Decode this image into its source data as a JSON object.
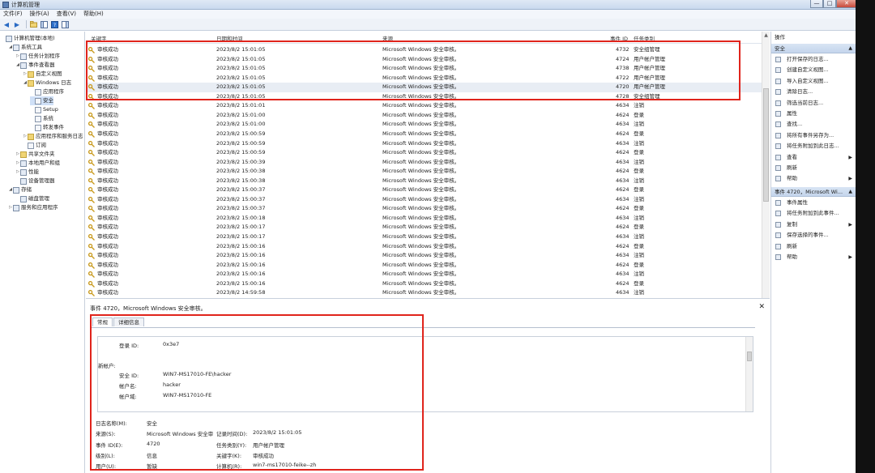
{
  "window": {
    "title": "计算机管理",
    "min": "—",
    "max": "□",
    "close": "✕"
  },
  "menu": [
    "文件(F)",
    "操作(A)",
    "查看(V)",
    "帮助(H)"
  ],
  "tree": [
    {
      "label": "计算机管理(本地)",
      "indent": 0,
      "tw": "",
      "icon": "computer-icon"
    },
    {
      "label": "系统工具",
      "indent": 1,
      "tw": "◢",
      "icon": "tools-icon"
    },
    {
      "label": "任务计划程序",
      "indent": 2,
      "tw": "▷",
      "icon": "clock-icon"
    },
    {
      "label": "事件查看器",
      "indent": 2,
      "tw": "◢",
      "icon": "event-viewer-icon"
    },
    {
      "label": "自定义视图",
      "indent": 3,
      "tw": "▷",
      "icon": "folder-icon"
    },
    {
      "label": "Windows 日志",
      "indent": 3,
      "tw": "◢",
      "icon": "folder-icon"
    },
    {
      "label": "应用程序",
      "indent": 4,
      "tw": "",
      "icon": "log-icon"
    },
    {
      "label": "安全",
      "indent": 4,
      "tw": "",
      "icon": "log-icon",
      "selected": true
    },
    {
      "label": "Setup",
      "indent": 4,
      "tw": "",
      "icon": "log-icon"
    },
    {
      "label": "系统",
      "indent": 4,
      "tw": "",
      "icon": "log-icon"
    },
    {
      "label": "转发事件",
      "indent": 4,
      "tw": "",
      "icon": "log-icon"
    },
    {
      "label": "应用程序和服务日志",
      "indent": 3,
      "tw": "▷",
      "icon": "folder-icon"
    },
    {
      "label": "订阅",
      "indent": 3,
      "tw": "",
      "icon": "log-icon"
    },
    {
      "label": "共享文件夹",
      "indent": 2,
      "tw": "▷",
      "icon": "shared-folder-icon"
    },
    {
      "label": "本地用户和组",
      "indent": 2,
      "tw": "▷",
      "icon": "users-icon"
    },
    {
      "label": "性能",
      "indent": 2,
      "tw": "▷",
      "icon": "performance-icon"
    },
    {
      "label": "设备管理器",
      "indent": 2,
      "tw": "",
      "icon": "device-icon"
    },
    {
      "label": "存储",
      "indent": 1,
      "tw": "◢",
      "icon": "storage-icon"
    },
    {
      "label": "磁盘管理",
      "indent": 2,
      "tw": "",
      "icon": "disk-icon"
    },
    {
      "label": "服务和应用程序",
      "indent": 1,
      "tw": "▷",
      "icon": "services-icon"
    }
  ],
  "columns": {
    "keyword": "关键字",
    "datetime": "日期和时间",
    "source": "来源",
    "event_id": "事件 ID",
    "category": "任务类别"
  },
  "events": [
    {
      "kw": "审核成功",
      "dt": "2023/8/2 15:01:05",
      "src": "Microsoft Windows 安全审核。",
      "id": "4732",
      "cat": "安全组管理"
    },
    {
      "kw": "审核成功",
      "dt": "2023/8/2 15:01:05",
      "src": "Microsoft Windows 安全审核。",
      "id": "4724",
      "cat": "用户帐户管理"
    },
    {
      "kw": "审核成功",
      "dt": "2023/8/2 15:01:05",
      "src": "Microsoft Windows 安全审核。",
      "id": "4738",
      "cat": "用户帐户管理"
    },
    {
      "kw": "审核成功",
      "dt": "2023/8/2 15:01:05",
      "src": "Microsoft Windows 安全审核。",
      "id": "4722",
      "cat": "用户帐户管理"
    },
    {
      "kw": "审核成功",
      "dt": "2023/8/2 15:01:05",
      "src": "Microsoft Windows 安全审核。",
      "id": "4720",
      "cat": "用户帐户管理",
      "selected": true
    },
    {
      "kw": "审核成功",
      "dt": "2023/8/2 15:01:05",
      "src": "Microsoft Windows 安全审核。",
      "id": "4728",
      "cat": "安全组管理"
    },
    {
      "kw": "审核成功",
      "dt": "2023/8/2 15:01:01",
      "src": "Microsoft Windows 安全审核。",
      "id": "4634",
      "cat": "注销"
    },
    {
      "kw": "审核成功",
      "dt": "2023/8/2 15:01:00",
      "src": "Microsoft Windows 安全审核。",
      "id": "4624",
      "cat": "登录"
    },
    {
      "kw": "审核成功",
      "dt": "2023/8/2 15:01:00",
      "src": "Microsoft Windows 安全审核。",
      "id": "4634",
      "cat": "注销"
    },
    {
      "kw": "审核成功",
      "dt": "2023/8/2 15:00:59",
      "src": "Microsoft Windows 安全审核。",
      "id": "4624",
      "cat": "登录"
    },
    {
      "kw": "审核成功",
      "dt": "2023/8/2 15:00:59",
      "src": "Microsoft Windows 安全审核。",
      "id": "4634",
      "cat": "注销"
    },
    {
      "kw": "审核成功",
      "dt": "2023/8/2 15:00:59",
      "src": "Microsoft Windows 安全审核。",
      "id": "4624",
      "cat": "登录"
    },
    {
      "kw": "审核成功",
      "dt": "2023/8/2 15:00:39",
      "src": "Microsoft Windows 安全审核。",
      "id": "4634",
      "cat": "注销"
    },
    {
      "kw": "审核成功",
      "dt": "2023/8/2 15:00:38",
      "src": "Microsoft Windows 安全审核。",
      "id": "4624",
      "cat": "登录"
    },
    {
      "kw": "审核成功",
      "dt": "2023/8/2 15:00:38",
      "src": "Microsoft Windows 安全审核。",
      "id": "4634",
      "cat": "注销"
    },
    {
      "kw": "审核成功",
      "dt": "2023/8/2 15:00:37",
      "src": "Microsoft Windows 安全审核。",
      "id": "4624",
      "cat": "登录"
    },
    {
      "kw": "审核成功",
      "dt": "2023/8/2 15:00:37",
      "src": "Microsoft Windows 安全审核。",
      "id": "4634",
      "cat": "注销"
    },
    {
      "kw": "审核成功",
      "dt": "2023/8/2 15:00:37",
      "src": "Microsoft Windows 安全审核。",
      "id": "4624",
      "cat": "登录"
    },
    {
      "kw": "审核成功",
      "dt": "2023/8/2 15:00:18",
      "src": "Microsoft Windows 安全审核。",
      "id": "4634",
      "cat": "注销"
    },
    {
      "kw": "审核成功",
      "dt": "2023/8/2 15:00:17",
      "src": "Microsoft Windows 安全审核。",
      "id": "4624",
      "cat": "登录"
    },
    {
      "kw": "审核成功",
      "dt": "2023/8/2 15:00:17",
      "src": "Microsoft Windows 安全审核。",
      "id": "4634",
      "cat": "注销"
    },
    {
      "kw": "审核成功",
      "dt": "2023/8/2 15:00:16",
      "src": "Microsoft Windows 安全审核。",
      "id": "4624",
      "cat": "登录"
    },
    {
      "kw": "审核成功",
      "dt": "2023/8/2 15:00:16",
      "src": "Microsoft Windows 安全审核。",
      "id": "4634",
      "cat": "注销"
    },
    {
      "kw": "审核成功",
      "dt": "2023/8/2 15:00:16",
      "src": "Microsoft Windows 安全审核。",
      "id": "4624",
      "cat": "登录"
    },
    {
      "kw": "审核成功",
      "dt": "2023/8/2 15:00:16",
      "src": "Microsoft Windows 安全审核。",
      "id": "4634",
      "cat": "注销"
    },
    {
      "kw": "审核成功",
      "dt": "2023/8/2 15:00:16",
      "src": "Microsoft Windows 安全审核。",
      "id": "4624",
      "cat": "登录"
    },
    {
      "kw": "审核成功",
      "dt": "2023/8/2 14:59:58",
      "src": "Microsoft Windows 安全审核。",
      "id": "4634",
      "cat": "注销"
    }
  ],
  "detail": {
    "title": "事件 4720，Microsoft Windows 安全审核。",
    "close": "✕",
    "tabs": [
      "常规",
      "详细信息"
    ],
    "desc_lines": [
      {
        "k": "登录 ID:",
        "v": "0x3e7",
        "indent": 1
      },
      {
        "k": "新帐户:",
        "v": "",
        "indent": 0
      },
      {
        "k": "安全 ID:",
        "v": "WIN7-MS17010-FE\\hacker",
        "indent": 1
      },
      {
        "k": "帐户名:",
        "v": "hacker",
        "indent": 1
      },
      {
        "k": "帐户域:",
        "v": "WIN7-MS17010-FE",
        "indent": 1
      }
    ],
    "props": [
      {
        "k": "日志名称(M):",
        "v": "安全",
        "k2": "",
        "v2": ""
      },
      {
        "k": "来源(S):",
        "v": "Microsoft Windows 安全审",
        "k2": "记录时间(D):",
        "v2": "2023/8/2 15:01:05"
      },
      {
        "k": "事件 ID(E):",
        "v": "4720",
        "k2": "任务类别(Y):",
        "v2": "用户帐户管理"
      },
      {
        "k": "级别(L):",
        "v": "信息",
        "k2": "关键字(K):",
        "v2": "审核成功"
      },
      {
        "k": "用户(U):",
        "v": "暂缺",
        "k2": "计算机(R):",
        "v2": "win7-ms17010-feike--zh"
      }
    ]
  },
  "actions": {
    "header": "操作",
    "section1": "安全",
    "items1": [
      {
        "label": "打开保存的日志...",
        "icon": "open-log-icon"
      },
      {
        "label": "创建自定义视图...",
        "icon": "filter-icon"
      },
      {
        "label": "导入自定义视图...",
        "icon": "import-icon"
      },
      {
        "label": "清除日志...",
        "icon": "clear-icon"
      },
      {
        "label": "筛选当前日志...",
        "icon": "filter-icon"
      },
      {
        "label": "属性",
        "icon": "properties-icon"
      },
      {
        "label": "查找...",
        "icon": "find-icon"
      },
      {
        "label": "将所有事件另存为...",
        "icon": "save-icon"
      },
      {
        "label": "将任务附加到此日志...",
        "icon": "attach-icon"
      },
      {
        "label": "查看",
        "icon": "view-icon",
        "submenu": true
      },
      {
        "label": "刷新",
        "icon": "refresh-icon"
      },
      {
        "label": "帮助",
        "icon": "help-icon",
        "submenu": true
      }
    ],
    "section2": "事件 4720，Microsoft Wi...",
    "items2": [
      {
        "label": "事件属性",
        "icon": "properties-icon"
      },
      {
        "label": "将任务附加到此事件...",
        "icon": "attach-icon"
      },
      {
        "label": "复制",
        "icon": "copy-icon",
        "submenu": true
      },
      {
        "label": "保存选择的事件...",
        "icon": "save-icon"
      },
      {
        "label": "刷新",
        "icon": "refresh-icon"
      },
      {
        "label": "帮助",
        "icon": "help-icon",
        "submenu": true
      }
    ]
  },
  "colors": {
    "annotation": "#e0241c",
    "selected_row": "#e8edf4"
  }
}
